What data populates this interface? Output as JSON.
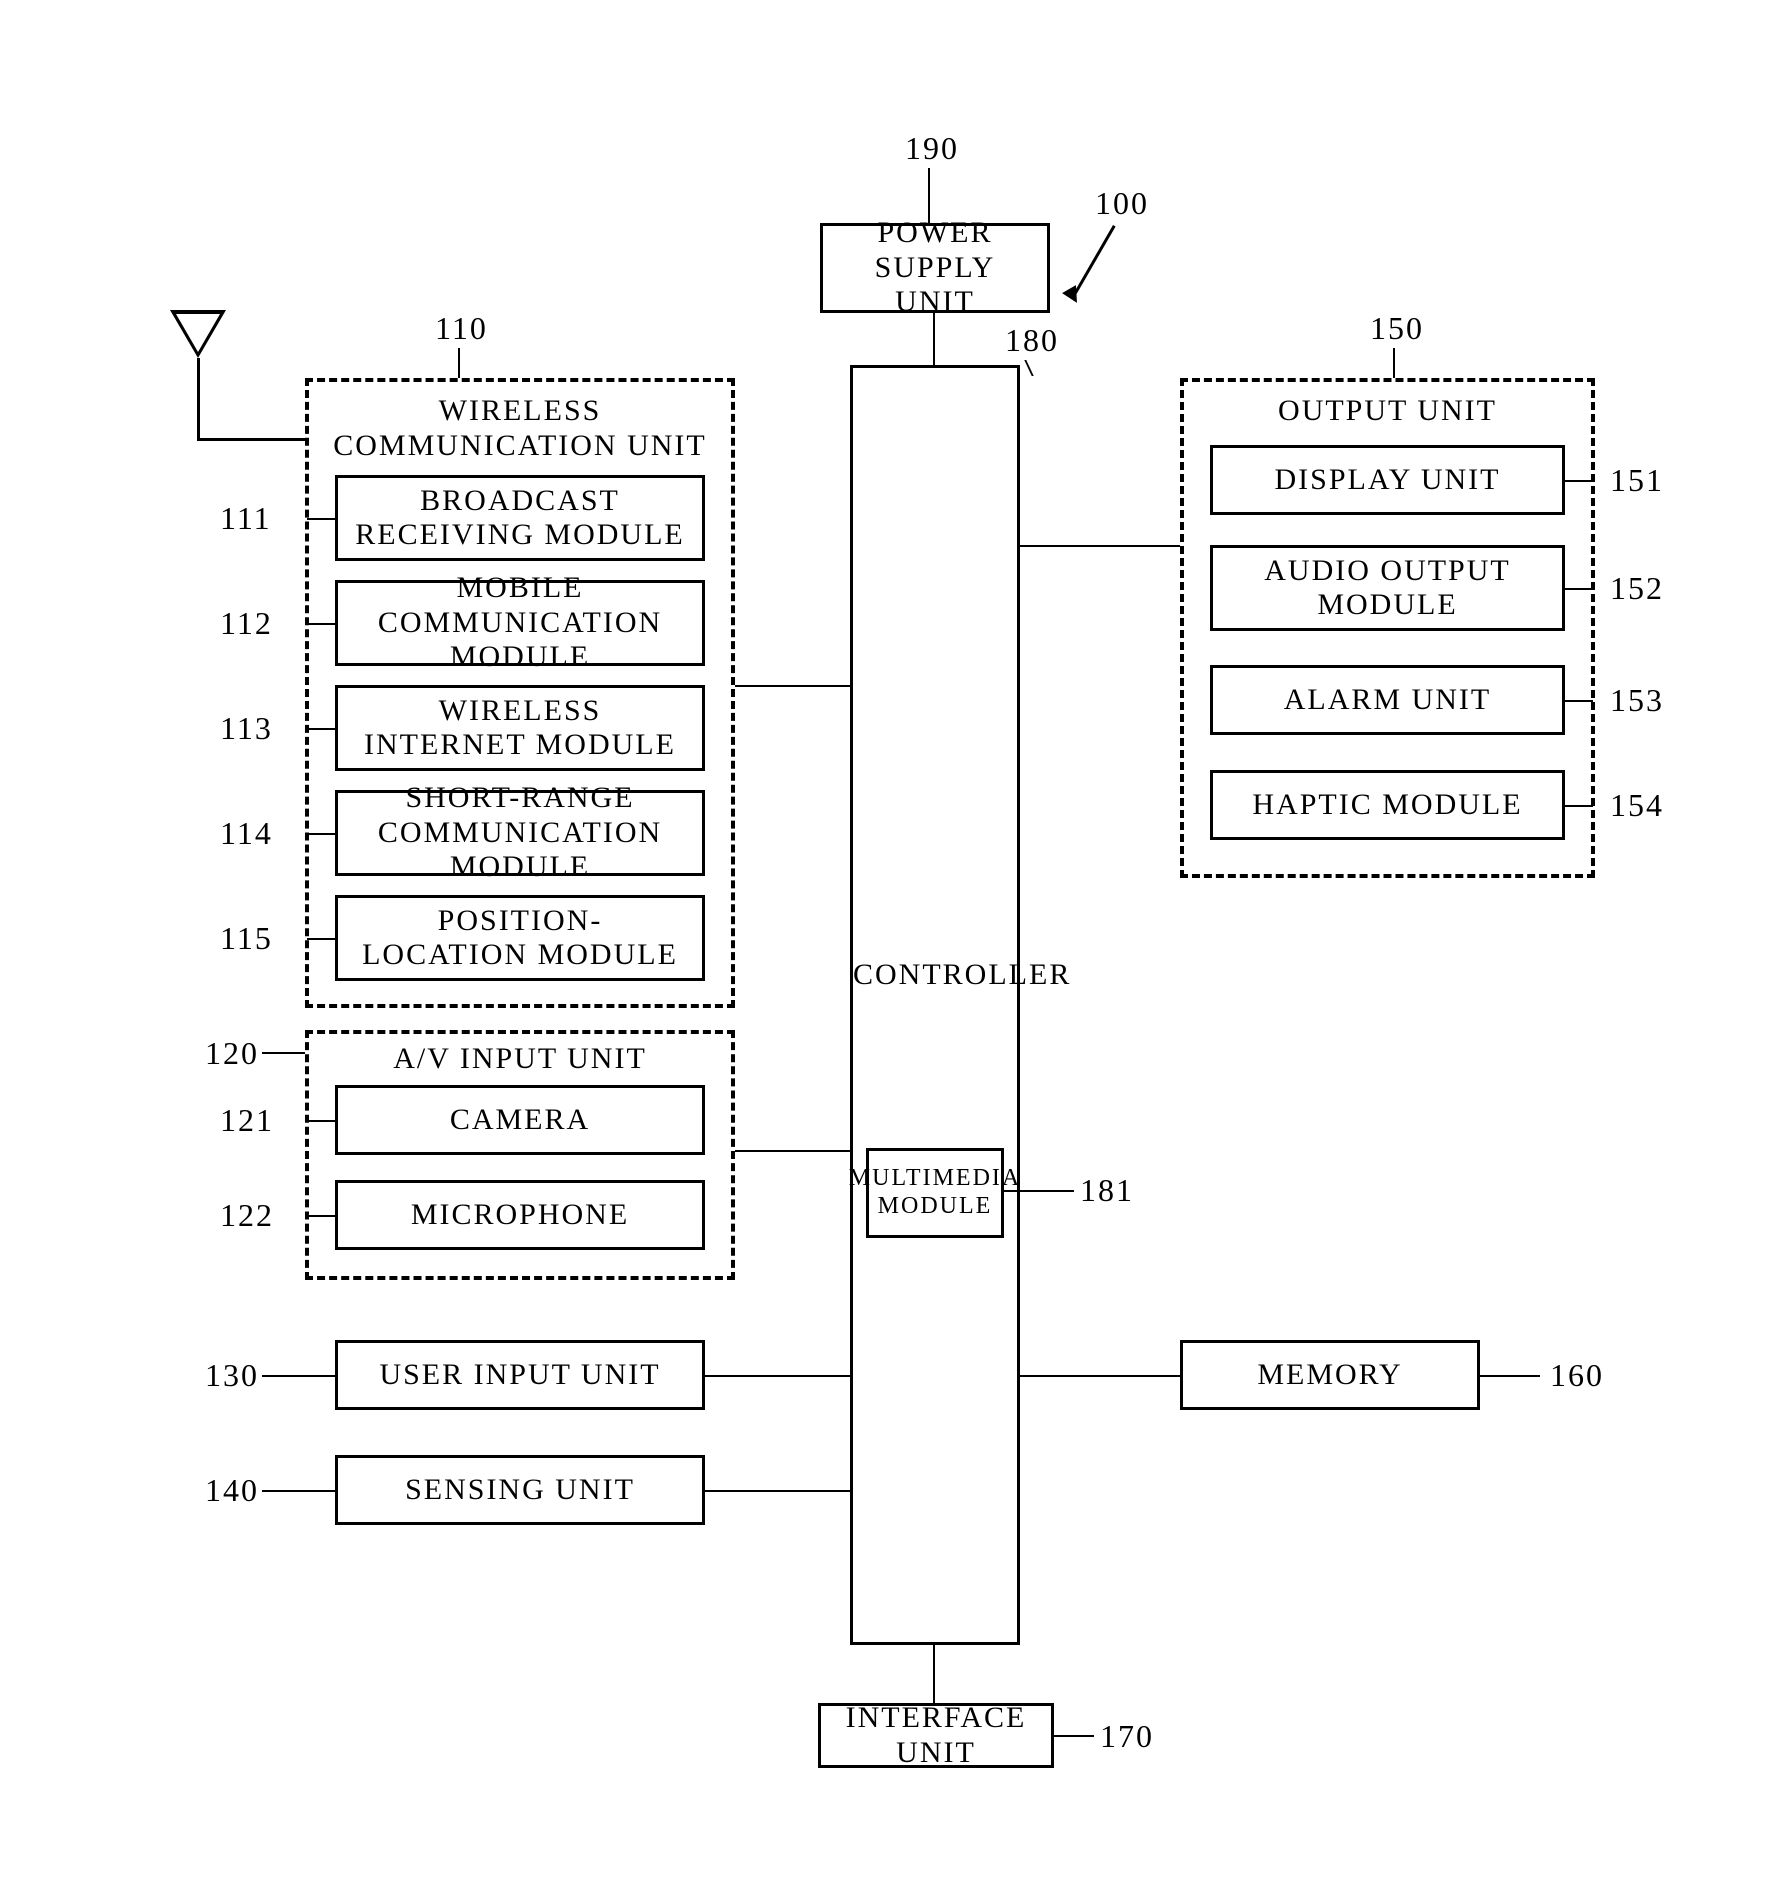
{
  "refs": {
    "r190": "190",
    "r100": "100",
    "r180": "180",
    "r110": "110",
    "r111": "111",
    "r112": "112",
    "r113": "113",
    "r114": "114",
    "r115": "115",
    "r120": "120",
    "r121": "121",
    "r122": "122",
    "r130": "130",
    "r140": "140",
    "r150": "150",
    "r151": "151",
    "r152": "152",
    "r153": "153",
    "r154": "154",
    "r160": "160",
    "r170": "170",
    "r181": "181"
  },
  "blocks": {
    "powerSupply": "POWER SUPPLY\nUNIT",
    "controller": "CONTROLLER",
    "multimedia": "MULTIMEDIA\nMODULE",
    "interface": "INTERFACE UNIT",
    "memory": "MEMORY",
    "userInput": "USER INPUT UNIT",
    "sensing": "SENSING UNIT",
    "wirelessGroup": "WIRELESS\nCOMMUNICATION UNIT",
    "broadcast": "BROADCAST\nRECEIVING MODULE",
    "mobileComm": "MOBILE\nCOMMUNICATION MODULE",
    "wirelessInternet": "WIRELESS\nINTERNET MODULE",
    "shortRange": "SHORT-RANGE\nCOMMUNICATION MODULE",
    "posLoc": "POSITION-\nLOCATION MODULE",
    "avGroup": "A/V INPUT UNIT",
    "camera": "CAMERA",
    "microphone": "MICROPHONE",
    "outputGroup": "OUTPUT UNIT",
    "displayUnit": "DISPLAY UNIT",
    "audioOut": "AUDIO OUTPUT\nMODULE",
    "alarm": "ALARM UNIT",
    "haptic": "HAPTIC MODULE"
  }
}
